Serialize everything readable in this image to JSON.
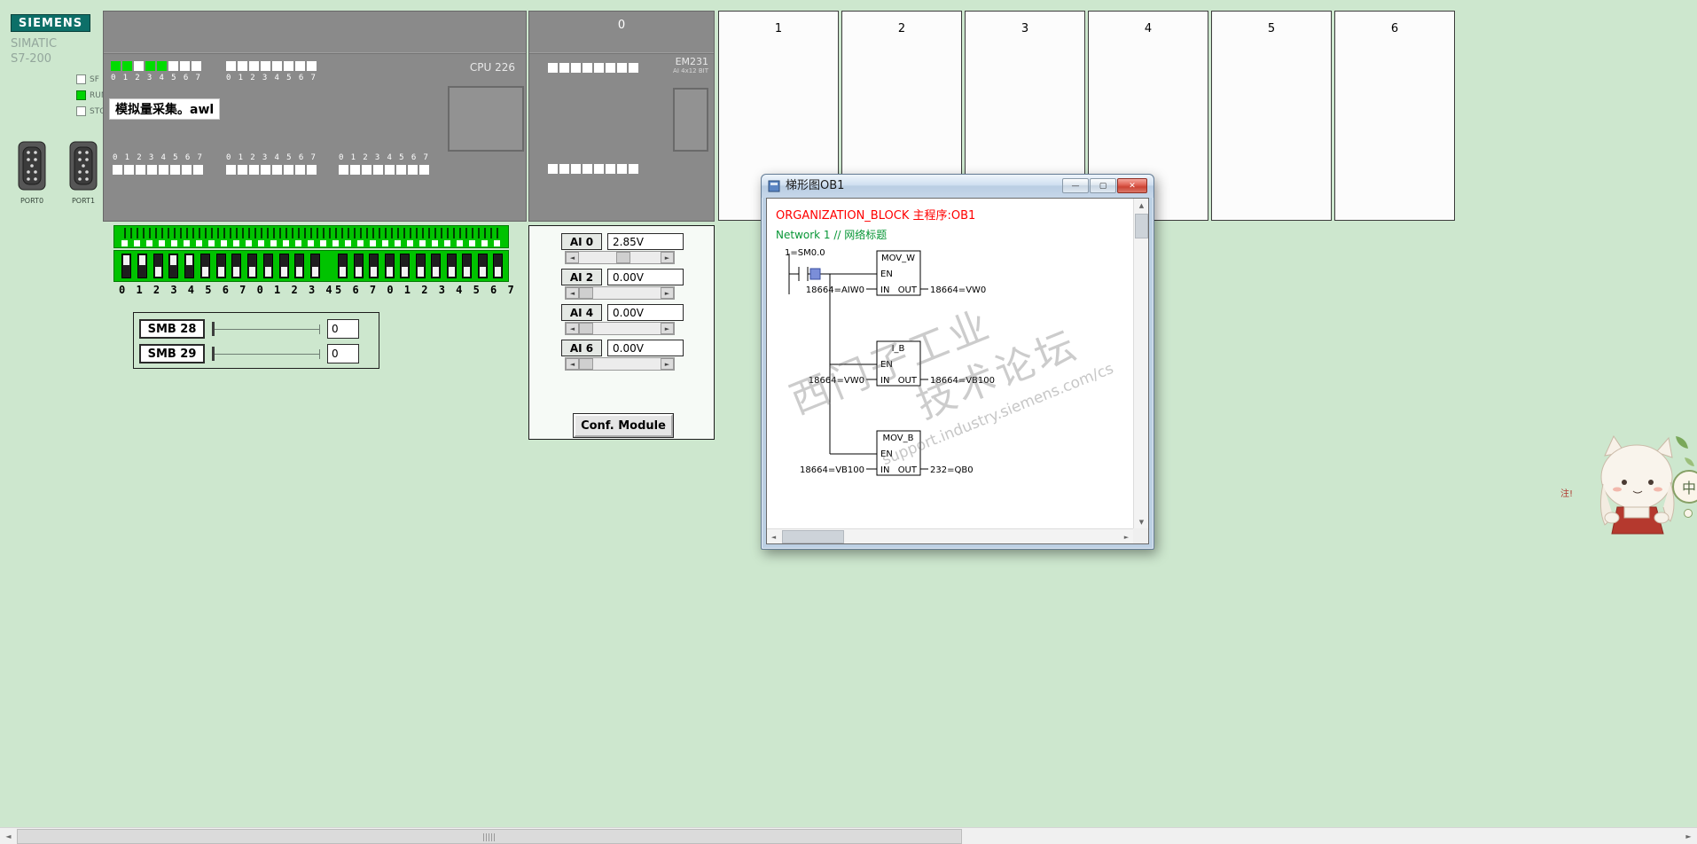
{
  "scroll_arrows": {
    "up": "▲",
    "down": "▼",
    "left": "◄",
    "right": "►"
  },
  "branding": {
    "logo": "SIEMENS",
    "family": "SIMATIC",
    "model": "S7-200",
    "status_leds": [
      {
        "label": "SF",
        "on": false
      },
      {
        "label": "RUN",
        "on": true
      },
      {
        "label": "STOP",
        "on": false
      }
    ],
    "ports": [
      {
        "label": "PORT0"
      },
      {
        "label": "PORT1"
      }
    ]
  },
  "cpu": {
    "model": "CPU 226",
    "program_file": "模拟量采集。awl",
    "digit_row": "0 1 2 3 4 5 6 7",
    "top_leds_group1": [
      1,
      1,
      0,
      1,
      1,
      0,
      0,
      0
    ],
    "top_leds_group2": [
      0,
      0,
      0,
      0,
      0,
      0,
      0,
      0
    ],
    "bottom_leds_group1": [
      0,
      0,
      0,
      0,
      0,
      0,
      0,
      0
    ],
    "bottom_leds_group2": [
      0,
      0,
      0,
      0,
      0,
      0,
      0,
      0
    ],
    "bottom_leds_group3": [
      0,
      0,
      0,
      0,
      0,
      0,
      0,
      0
    ]
  },
  "expansion_module": {
    "slot_number": "0",
    "model": "EM231",
    "spec": "AI 4x12 BIT",
    "top_leds": [
      0,
      0,
      0,
      0,
      0,
      0,
      0,
      0
    ],
    "bottom_leds": [
      0,
      0,
      0,
      0,
      0,
      0,
      0,
      0
    ]
  },
  "empty_slots": [
    "1",
    "2",
    "3",
    "4",
    "5",
    "6"
  ],
  "io_terminals": {
    "left_numbers": "0 1 2 3 4 5 6 7 0 1 2 3 4",
    "right_numbers": "5 6 7 0 1 2 3 4 5 6 7",
    "switches_left": [
      1,
      1,
      0,
      1,
      1,
      0,
      0,
      0,
      0,
      0,
      0,
      0,
      0
    ],
    "switches_right": [
      0,
      0,
      0,
      0,
      0,
      0,
      0,
      0,
      0,
      0,
      0
    ]
  },
  "smb_panel": {
    "rows": [
      {
        "label": "SMB 28",
        "value": "0",
        "pos": 0
      },
      {
        "label": "SMB 29",
        "value": "0",
        "pos": 0
      }
    ]
  },
  "analog_panel": {
    "channels": [
      {
        "label": "AI 0",
        "value": "2.85V",
        "slider_pos": 0.55
      },
      {
        "label": "AI 2",
        "value": "0.00V",
        "slider_pos": 0
      },
      {
        "label": "AI 4",
        "value": "0.00V",
        "slider_pos": 0
      },
      {
        "label": "AI 6",
        "value": "0.00V",
        "slider_pos": 0
      }
    ],
    "config_button_label": "Conf. Module"
  },
  "ladder_window": {
    "title": "梯形图OB1",
    "window_buttons": [
      {
        "name": "minimize",
        "glyph": "—"
      },
      {
        "name": "maximize",
        "glyph": "▢"
      },
      {
        "name": "close",
        "glyph": "✕"
      }
    ],
    "block_header": "ORGANIZATION_BLOCK 主程序:OB1",
    "network_label": "Network 1 //  网络标题",
    "contact_label": "1=SM0.0",
    "pin_labels": {
      "en": "EN",
      "in": "IN",
      "out": "OUT"
    },
    "rungs": [
      {
        "name": "MOV_W",
        "in_value": "18664=AIW0",
        "out_value": "18664=VW0"
      },
      {
        "name": "I_B",
        "in_value": "18664=VW0",
        "out_value": "18664=VB100"
      },
      {
        "name": "MOV_B",
        "in_value": "18664=VB100",
        "out_value": "232=QB0"
      }
    ]
  },
  "watermark": {
    "line1": "西门子工业",
    "line2": "技术论坛",
    "line3": "support.industry.siemens.com/cs"
  },
  "mascot": {
    "note": "注!",
    "badge": "中"
  }
}
